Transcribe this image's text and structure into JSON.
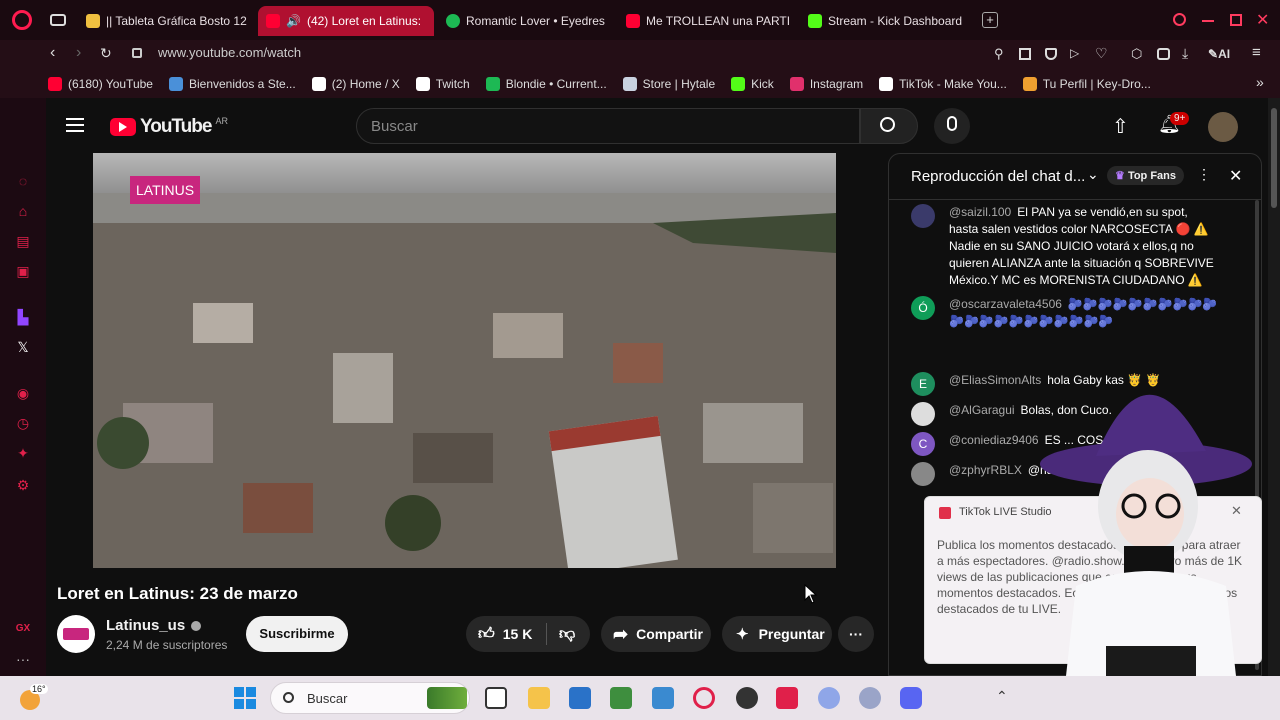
{
  "browser": {
    "tabs": [
      {
        "label": "|| Tableta Gráfica Bosto 12",
        "color": "#f0c040"
      },
      {
        "label": "(42) Loret en Latinus:",
        "color": "#ff0033"
      },
      {
        "label": "Romantic Lover • Eyedres",
        "color": "#1db954"
      },
      {
        "label": "Me TROLLEAN una PARTI",
        "color": "#ff0033"
      },
      {
        "label": "Stream - Kick Dashboard",
        "color": "#53fc18"
      }
    ],
    "url": "www.youtube.com/watch",
    "bookmarks": [
      {
        "label": "(6180) YouTube",
        "color": "#ff0033"
      },
      {
        "label": "Bienvenidos a Ste...",
        "color": "#4a90d9"
      },
      {
        "label": "(2) Home / X",
        "color": "#ffffff"
      },
      {
        "label": "Twitch",
        "color": "#ffffff"
      },
      {
        "label": "Blondie • Current...",
        "color": "#1db954"
      },
      {
        "label": "Store | Hytale",
        "color": "#c9d2e0"
      },
      {
        "label": "Kick",
        "color": "#53fc18"
      },
      {
        "label": "Instagram",
        "color": "#e1306c"
      },
      {
        "label": "TikTok - Make You...",
        "color": "#ffffff"
      },
      {
        "label": "Tu Perfil | Key-Dro...",
        "color": "#f0a030"
      }
    ],
    "ai_label": "AI",
    "sidebar_gx": "GX"
  },
  "youtube": {
    "logo_text": "YouTube",
    "logo_region": "AR",
    "search_placeholder": "Buscar",
    "notif_badge": "9+",
    "video": {
      "channel_logo_text": "LATINUS",
      "title": "Loret en Latinus: 23 de marzo",
      "channel_name": "Latinus_us",
      "subscribers": "2,24 M de suscriptores",
      "subscribe_label": "Suscribirme",
      "like_count": "15 K",
      "share_label": "Compartir",
      "ask_label": "Preguntar"
    },
    "chat": {
      "header_title": "Reproducción del chat d...",
      "top_fans_label": "Top Fans",
      "messages": [
        {
          "author": "@saizil.100",
          "text": "El PAN ya se vendió,en su spot, hasta salen vestidos color NARCOSECTA 🔴 ⚠️ Nadie en su SANO JUICIO votará x ellos,q no quieren ALIANZA ante la situación q SOBREVIVE México.Y MC es MORENISTA CIUDADANO ⚠️",
          "avatar_letter": "",
          "avatar_color": "#3a3a6a"
        },
        {
          "author": "@oscarzavaleta4506",
          "text": "🫐🫐🫐🫐🫐🫐🫐🫐🫐🫐🫐🫐🫐🫐🫐🫐🫐🫐🫐🫐🫐",
          "avatar_letter": "Ó",
          "avatar_color": "#0f9d58"
        },
        {
          "author": "@EliasSimonAlts",
          "text": "hola Gaby kas 🤴 🤴",
          "avatar_letter": "E",
          "avatar_color": "#1e8e5e"
        },
        {
          "author": "@AlGaragui",
          "text": "Bolas, don Cuco.",
          "avatar_letter": "",
          "avatar_color": "#dddddd"
        },
        {
          "author": "@coniediaz9406",
          "text": "ES ... COSAS",
          "avatar_letter": "C",
          "avatar_color": "#7e57c2"
        },
        {
          "author": "@zphyrRBLX",
          "text": "@na ... además quiere hacer su fra",
          "avatar_letter": "",
          "avatar_color": "#888888"
        }
      ]
    },
    "tiktok_popup": {
      "app_name": "TikTok LIVE Studio",
      "body": "Publica los momentos destacados de tu LIVE para atraer a más espectadores. @radio.show.arg obtuvo más de 1K views de las publicaciones que compartió de sus momentos destacados. Echa un vistazo a los momentos destacados de tu LIVE."
    }
  },
  "taskbar": {
    "temperature": "16°",
    "search_placeholder": "Buscar"
  }
}
